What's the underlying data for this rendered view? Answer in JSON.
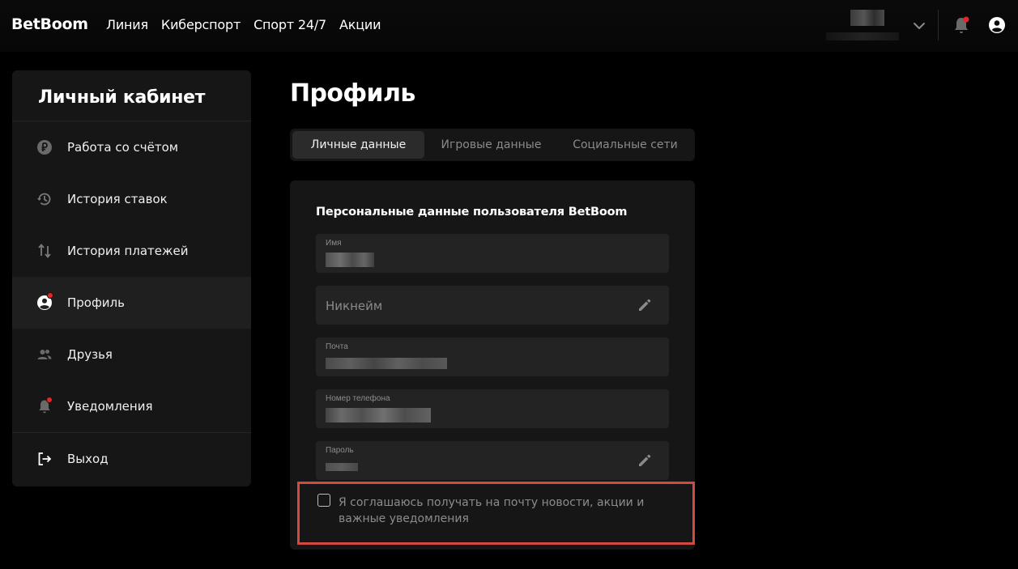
{
  "header": {
    "logo": "BetBoom",
    "nav": [
      "Линия",
      "Киберспорт",
      "Спорт 24/7",
      "Акции"
    ]
  },
  "sidebar": {
    "title": "Личный кабинет",
    "items": [
      {
        "label": "Работа со счётом",
        "icon": "ruble-coin-icon"
      },
      {
        "label": "История ставок",
        "icon": "history-icon"
      },
      {
        "label": "История платежей",
        "icon": "transfer-arrows-icon"
      },
      {
        "label": "Профиль",
        "icon": "user-circle-icon",
        "active": true,
        "badge": true
      },
      {
        "label": "Друзья",
        "icon": "friends-icon"
      },
      {
        "label": "Уведомления",
        "icon": "bell-icon",
        "badge": true
      },
      {
        "label": "Выход",
        "icon": "logout-icon"
      }
    ]
  },
  "main": {
    "title": "Профиль",
    "tabs": [
      "Личные данные",
      "Игровые данные",
      "Социальные сети"
    ],
    "active_tab": 0,
    "section_title": "Персональные данные пользователя BetBoom",
    "fields": {
      "name": {
        "label": "Имя"
      },
      "nickname": {
        "placeholder": "Никнейм"
      },
      "email": {
        "label": "Почта"
      },
      "phone": {
        "label": "Номер телефона"
      },
      "password": {
        "label": "Пароль"
      }
    },
    "consent": {
      "text": "Я соглашаюсь получать на почту новости, акции и важные уведомления",
      "checked": false
    }
  },
  "colors": {
    "accent_red": "#e8232a",
    "highlight_border": "#d44a3f",
    "panel": "#161616",
    "field": "#232323"
  }
}
